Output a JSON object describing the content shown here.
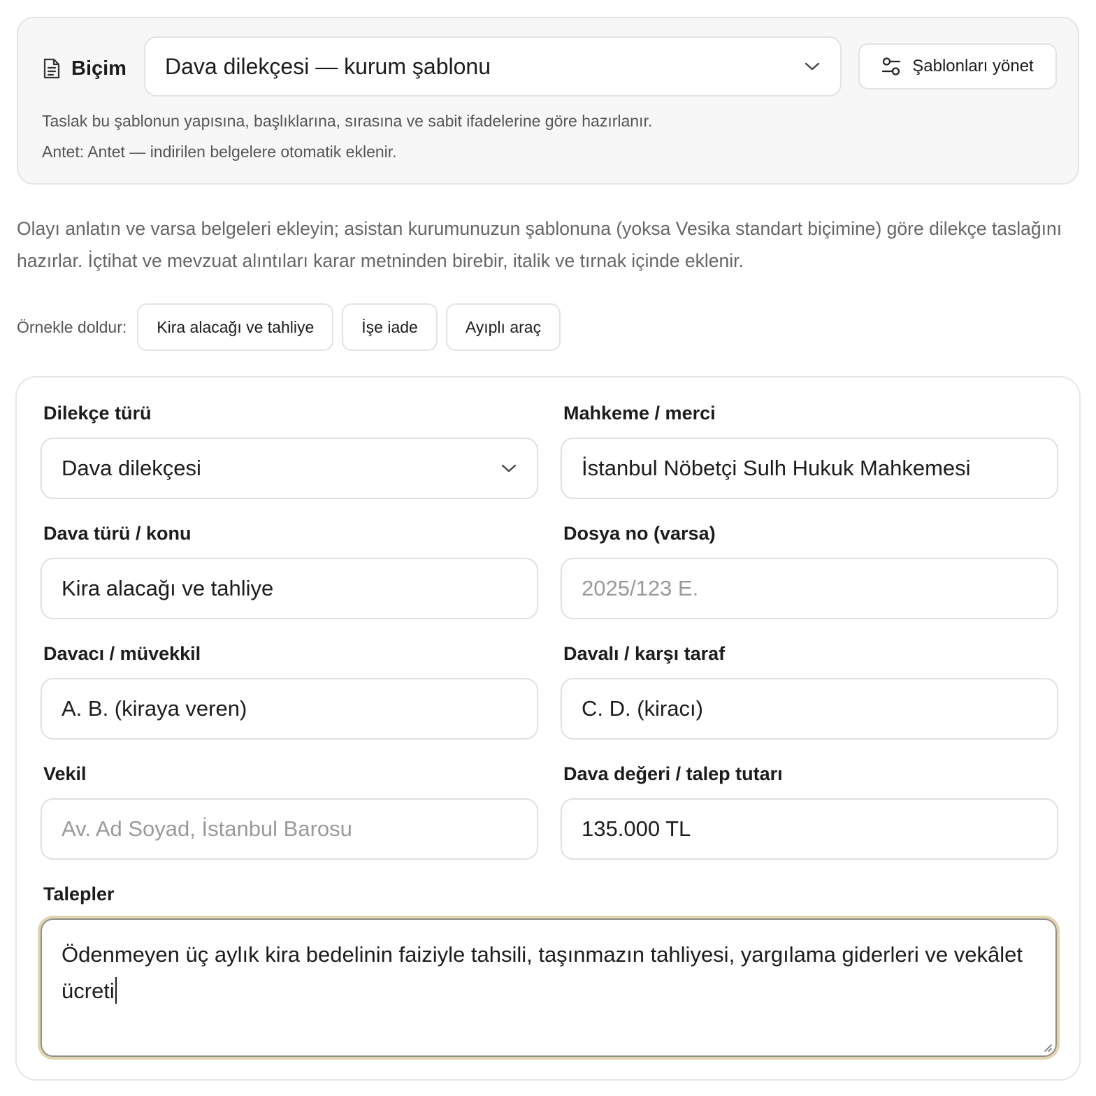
{
  "format": {
    "label": "Biçim",
    "template_value": "Dava dilekçesi — kurum şablonu",
    "manage_button": "Şablonları yönet",
    "note_1": "Taslak bu şablonun yapısına, başlıklarına, sırasına ve sabit ifadelerine göre hazırlanır.",
    "note_2": "Antet: Antet — indirilen belgelere otomatik eklenir."
  },
  "intro": "Olayı anlatın ve varsa belgeleri ekleyin; asistan kurumunuzun şablonuna (yoksa Vesika standart biçimine) göre dilekçe taslağını hazırlar. İçtihat ve mevzuat alıntıları karar metninden birebir, italik ve tırnak içinde eklenir.",
  "samples": {
    "label": "Örnekle doldur:",
    "chips": [
      "Kira alacağı ve tahliye",
      "İşe iade",
      "Ayıplı araç"
    ]
  },
  "form": {
    "petition_type": {
      "label": "Dilekçe türü",
      "value": "Dava dilekçesi"
    },
    "court": {
      "label": "Mahkeme / merci",
      "value": "İstanbul Nöbetçi Sulh Hukuk Mahkemesi"
    },
    "case_type": {
      "label": "Dava türü / konu",
      "value": "Kira alacağı ve tahliye"
    },
    "file_no": {
      "label": "Dosya no (varsa)",
      "value": "",
      "placeholder": "2025/123 E."
    },
    "plaintiff": {
      "label": "Davacı / müvekkil",
      "value": "A. B. (kiraya veren)"
    },
    "defendant": {
      "label": "Davalı / karşı taraf",
      "value": "C. D. (kiracı)"
    },
    "attorney": {
      "label": "Vekil",
      "value": "",
      "placeholder": "Av. Ad Soyad, İstanbul Barosu"
    },
    "amount": {
      "label": "Dava değeri / talep tutarı",
      "value": "135.000 TL"
    },
    "requests": {
      "label": "Talepler",
      "value": "Ödenmeyen üç aylık kira bedelinin faiziyle tahsili, taşınmazın tahliyesi, yargılama giderleri ve vekâlet ücreti"
    }
  },
  "icons": {
    "format": "document-icon",
    "template_select": "chevron-down-icon",
    "manage": "sliders-icon",
    "resize": "resize-handle-icon"
  },
  "colors": {
    "panel_bg": "#f7f7f7",
    "border": "#e3e3e3",
    "focus_ring": "#e2d4ad",
    "text": "#1c1c1c",
    "muted": "#666666",
    "placeholder": "#9a9a9a"
  }
}
